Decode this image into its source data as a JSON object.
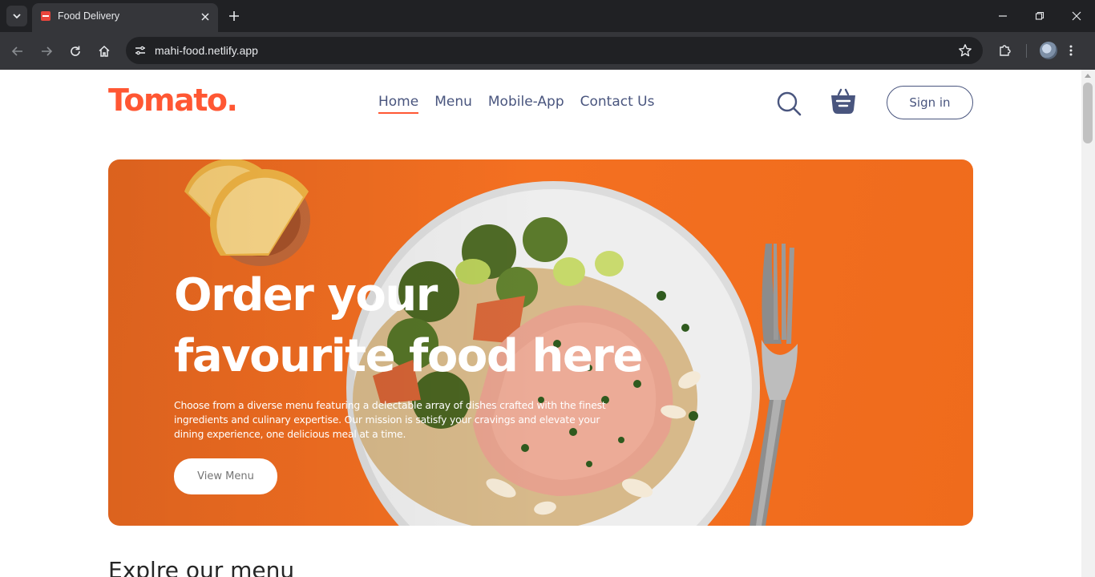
{
  "browser": {
    "tab_title": "Food Delivery",
    "url": "mahi-food.netlify.app"
  },
  "navbar": {
    "logo": "Tomato.",
    "links": [
      {
        "label": "Home",
        "active": true
      },
      {
        "label": "Menu",
        "active": false
      },
      {
        "label": "Mobile-App",
        "active": false
      },
      {
        "label": "Contact Us",
        "active": false
      }
    ],
    "signin_label": "Sign in",
    "accent_color": "#ff5733",
    "text_color": "#49557e"
  },
  "hero": {
    "title_line1": "Order your",
    "title_line2": "favourite food here",
    "description": "Choose from a diverse menu featuring a delectable array of dishes crafted with the finest ingredients and culinary expertise. Our mission is satisfy your cravings and elevate your dining experience, one delicious meal at a time.",
    "button_label": "View Menu",
    "background_color": "#f47021"
  },
  "section": {
    "title": "Explre our menu"
  },
  "icons": {
    "search": "search-icon",
    "basket": "basket-icon"
  }
}
